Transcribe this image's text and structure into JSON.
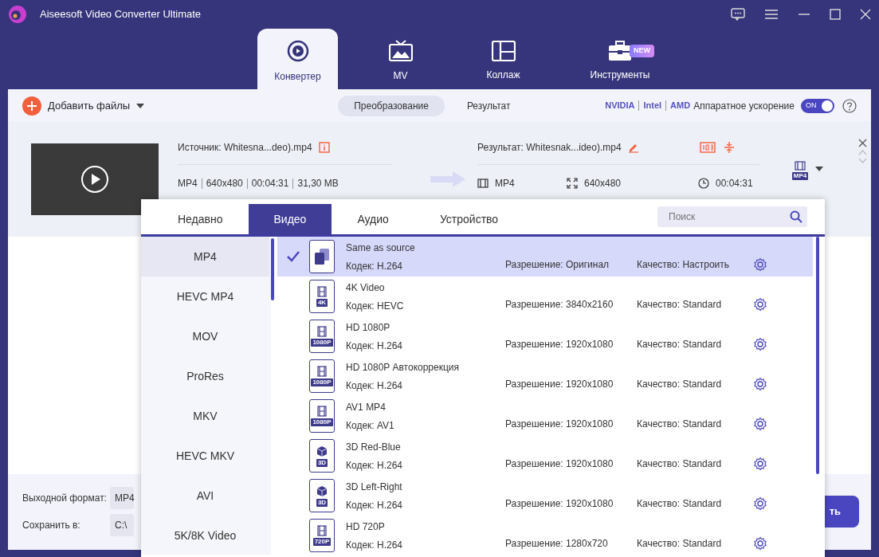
{
  "window": {
    "title": "Aiseesoft Video Converter Ultimate"
  },
  "main_tabs": [
    {
      "label": "Конвертер",
      "selected": true,
      "kind": "converter"
    },
    {
      "label": "MV",
      "selected": false,
      "kind": "mv"
    },
    {
      "label": "Коллаж",
      "selected": false,
      "kind": "collage"
    },
    {
      "label": "Инструменты",
      "selected": false,
      "kind": "toolbox",
      "badge": "NEW"
    }
  ],
  "toolbar": {
    "add_files": "Добавить файлы",
    "view_tabs": [
      {
        "label": "Преобразование",
        "selected": true
      },
      {
        "label": "Результат",
        "selected": false
      }
    ],
    "gpu": [
      "NVIDIA",
      "Intel",
      "AMD"
    ],
    "acceleration_label": "Аппаратное ускорение",
    "acceleration_toggle": {
      "label": "ON",
      "on": true
    }
  },
  "file": {
    "source": "Источник: Whitesna...deo).mp4",
    "format": "MP4",
    "resolution": "640x480",
    "duration": "00:04:31",
    "size": "31,30 MB",
    "result": "Результат: Whitesnak...ideo).mp4",
    "out_format": "MP4",
    "out_resolution": "640x480",
    "out_duration": "00:04:31",
    "format_badge": "MP4"
  },
  "popup": {
    "tabs": [
      {
        "label": "Недавно",
        "selected": false
      },
      {
        "label": "Видео",
        "selected": true
      },
      {
        "label": "Аудио",
        "selected": false
      },
      {
        "label": "Устройство",
        "selected": false
      }
    ],
    "search": {
      "placeholder": "Поиск"
    },
    "formats": [
      {
        "label": "MP4",
        "selected": true
      },
      {
        "label": "HEVC MP4",
        "selected": false
      },
      {
        "label": "MOV",
        "selected": false
      },
      {
        "label": "ProRes",
        "selected": false
      },
      {
        "label": "MKV",
        "selected": false
      },
      {
        "label": "HEVC MKV",
        "selected": false
      },
      {
        "label": "AVI",
        "selected": false
      },
      {
        "label": "5K/8K Video",
        "selected": false
      }
    ],
    "presets": [
      {
        "name": "Same as source",
        "codec": "Кодек: H.264",
        "resolution": "Разрешение: Оригинал",
        "quality": "Качество: Настроить",
        "selected": true,
        "kind": "copy"
      },
      {
        "name": "4K Video",
        "codec": "Кодек: HEVC",
        "resolution": "Разрешение: 3840x2160",
        "quality": "Качество: Standard",
        "selected": false,
        "kind": "film",
        "badge": "4K"
      },
      {
        "name": "HD 1080P",
        "codec": "Кодек: H.264",
        "resolution": "Разрешение: 1920x1080",
        "quality": "Качество: Standard",
        "selected": false,
        "kind": "film",
        "badge": "1080P"
      },
      {
        "name": "HD 1080P Автокоррекция",
        "codec": "Кодек: H.264",
        "resolution": "Разрешение: 1920x1080",
        "quality": "Качество: Standard",
        "selected": false,
        "kind": "film",
        "badge": "1080P"
      },
      {
        "name": "AV1 MP4",
        "codec": "Кодек: AV1",
        "resolution": "Разрешение: 1920x1080",
        "quality": "Качество: Standard",
        "selected": false,
        "kind": "film",
        "badge": "1080P"
      },
      {
        "name": "3D Red-Blue",
        "codec": "Кодек: H.264",
        "resolution": "Разрешение: 1920x1080",
        "quality": "Качество: Standard",
        "selected": false,
        "kind": "cube",
        "badge": "3D"
      },
      {
        "name": "3D Left-Right",
        "codec": "Кодек: H.264",
        "resolution": "Разрешение: 1920x1080",
        "quality": "Качество: Standard",
        "selected": false,
        "kind": "cube",
        "badge": "3D"
      },
      {
        "name": "HD 720P",
        "codec": "Кодек: H.264",
        "resolution": "Разрешение: 1280x720",
        "quality": "Качество: Standard",
        "selected": false,
        "kind": "film",
        "badge": "720P"
      }
    ]
  },
  "bottom": {
    "output_format_label": "Выходной формат:",
    "output_format_value": "MP4",
    "save_label": "Сохранить в:",
    "save_value": "C:\\",
    "convert_button": "ть"
  }
}
